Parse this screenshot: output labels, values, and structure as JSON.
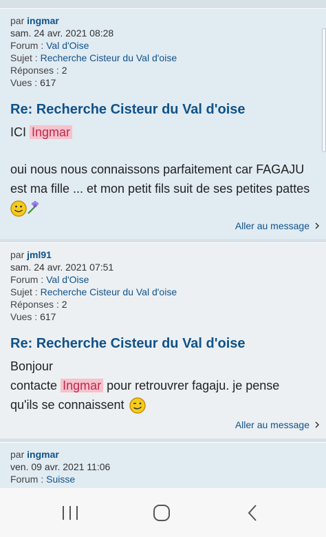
{
  "posts": [
    {
      "by_prefix": "par",
      "author": "ingmar",
      "date": "sam. 24 avr. 2021 08:28",
      "forum_label": "Forum :",
      "forum": "Val d'Oise",
      "subject_label": "Sujet :",
      "subject": "Recherche Cisteur du Val d'oise",
      "replies_label": "Réponses :",
      "replies": "2",
      "views_label": "Vues :",
      "views": "617",
      "title": "Re: Recherche Cisteur du Val d'oise",
      "line1_prefix": "ICI",
      "line1_hl": "Ingmar",
      "para1": "oui nous nous connaissons parfaitement car FAGAJU est ma fille ... et mon petit fils suit de ses petites pattes",
      "goto": "Aller au message"
    },
    {
      "by_prefix": "par",
      "author": "jml91",
      "date": "sam. 24 avr. 2021 07:51",
      "forum_label": "Forum :",
      "forum": "Val d'Oise",
      "subject_label": "Sujet :",
      "subject": "Recherche Cisteur du Val d'oise",
      "replies_label": "Réponses :",
      "replies": "2",
      "views_label": "Vues :",
      "views": "617",
      "title": "Re: Recherche Cisteur du Val d'oise",
      "line1": "Bonjour",
      "line2_prefix": "contacte",
      "line2_hl": "Ingmar",
      "line2_suffix": "pour retrouvrer fagaju. je pense",
      "line3": "qu'ils se connaissent",
      "goto": "Aller au message"
    },
    {
      "by_prefix": "par",
      "author": "ingmar",
      "date": "ven. 09 avr. 2021 11:06",
      "forum_label": "Forum :",
      "forum": "Suisse"
    }
  ],
  "icons": {
    "smiley1": "smiley-flower-icon",
    "smiley2": "wink-icon",
    "nav_recents": "recent-apps-icon",
    "nav_home": "home-icon",
    "nav_back": "back-icon"
  }
}
